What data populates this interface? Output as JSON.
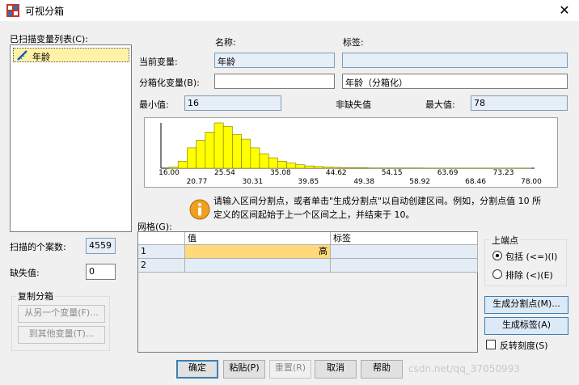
{
  "window": {
    "title": "可视分箱",
    "close_glyph": "✕"
  },
  "left": {
    "list_label": "已扫描变量列表(C):",
    "list_label_key": "C",
    "items": [
      {
        "label": "年龄",
        "icon": "ruler-icon"
      }
    ],
    "case_count_label": "扫描的个案数:",
    "case_count": "4559",
    "missing_label": "缺失值:",
    "missing": "0",
    "copy_group_label": "复制分箱",
    "copy_from_label": "从另一个变量(F)...",
    "copy_to_label": "到其他变量(T)..."
  },
  "vars": {
    "name_header": "名称:",
    "label_header": "标签:",
    "current_label": "当前变量:",
    "current_name": "年龄",
    "current_label_value": "",
    "binned_label": "分箱化变量(B):",
    "binned_name": "",
    "binned_label_value": "年龄（分箱化）",
    "min_label": "最小值:",
    "min": "16",
    "nonmissing_label": "非缺失值",
    "max_label": "最大值:",
    "max": "78"
  },
  "chart_data": {
    "type": "bar",
    "xlim": [
      16,
      78
    ],
    "ticks_top": [
      "16.00",
      "25.54",
      "35.08",
      "44.62",
      "54.15",
      "63.69",
      "73.23"
    ],
    "ticks_bottom": [
      "20.77",
      "30.31",
      "39.85",
      "49.38",
      "58.92",
      "68.46",
      "78.00"
    ],
    "bin_width": 1.55,
    "values": [
      2,
      12,
      35,
      48,
      62,
      78,
      72,
      58,
      50,
      35,
      25,
      18,
      12,
      9,
      6,
      4,
      3,
      2,
      1.5,
      1,
      1,
      1,
      0.5,
      0.5,
      0.5,
      0.5,
      0.5,
      0.5,
      0.3,
      0.3,
      0.3,
      0.3,
      0.3,
      0.3,
      0.2,
      0.2,
      0.2,
      0.2,
      0.2,
      0.2
    ]
  },
  "info": {
    "line1": "请输入区间分割点，或者单击\"生成分割点\"以自动创建区间。例如，分割点值 10 所",
    "line2": "定义的区间起始于上一个区间之上，并结束于 10。",
    "icon": "info-icon"
  },
  "grid": {
    "label": "网格(G):",
    "headers": [
      "值",
      "标签"
    ],
    "rows": [
      {
        "num": "1",
        "value": "高",
        "label": ""
      },
      {
        "num": "2",
        "value": "",
        "label": ""
      }
    ]
  },
  "endpoint": {
    "group_label": "上端点",
    "include_label": "包括 (<=)(I)",
    "exclude_label": "排除 (<)(E)",
    "selected": "include"
  },
  "actions": {
    "make_cutpoints": "生成分割点(M)...",
    "make_labels": "生成标签(A)",
    "reverse_label": "反转刻度(S)"
  },
  "footer": {
    "ok": "确定",
    "paste": "粘贴(P)",
    "reset": "重置(R)",
    "cancel": "取消",
    "help": "帮助"
  },
  "watermark": "csdn.net/qq_37050993",
  "colors": {
    "bar": "#ffff00",
    "selected_row": "#ffd97a",
    "accent": "#3c7fb1"
  }
}
